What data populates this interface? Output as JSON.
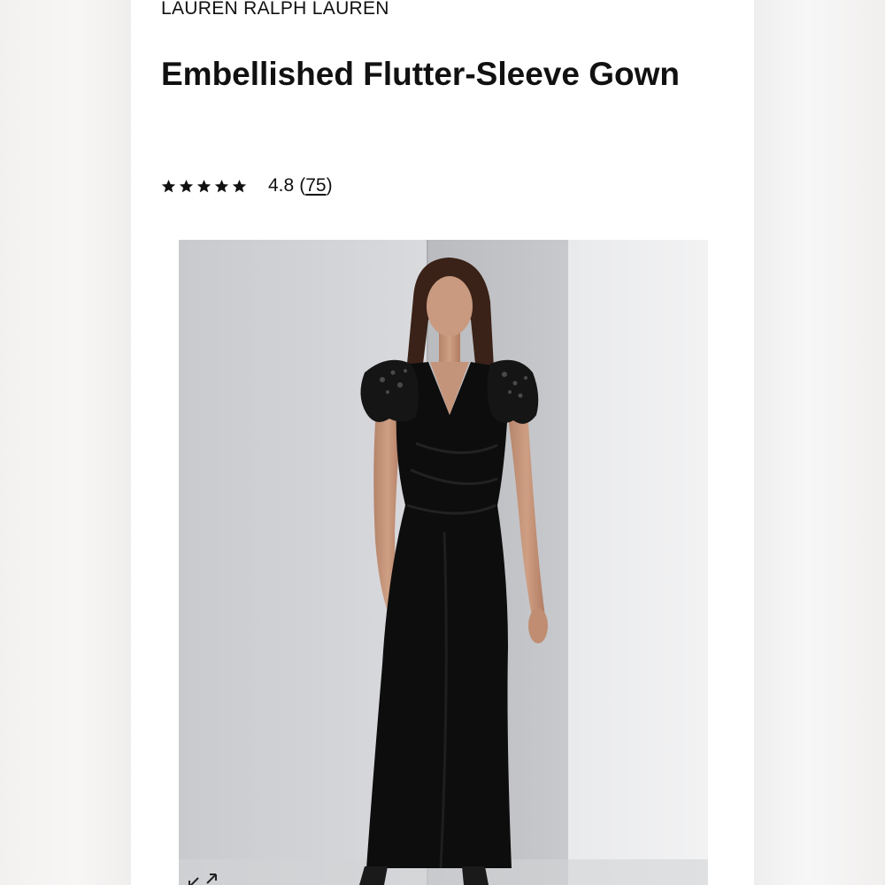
{
  "product": {
    "brand": "LAUREN RALPH LAUREN",
    "title": "Embellished Flutter-Sleeve Gown",
    "rating": {
      "stars": 5,
      "score": "4.8",
      "review_count": "75",
      "open_paren": "(",
      "close_paren": ")"
    }
  },
  "image": {
    "alt": "Model wearing black embellished flutter-sleeve gown",
    "icon": "expand-icon"
  },
  "colors": {
    "text": "#111111",
    "gown": "#0d0d0d",
    "backdrop": "#cfd0d3"
  }
}
